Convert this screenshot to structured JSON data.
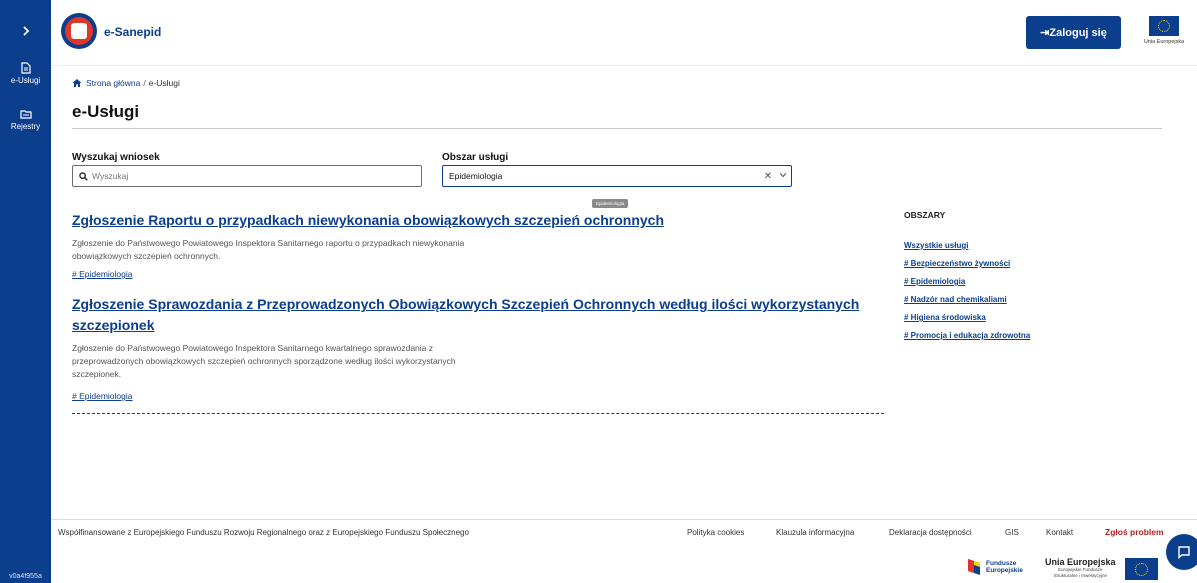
{
  "sidebar": {
    "toggle_icon": "chevron-right-icon",
    "items": [
      {
        "label": "e-Usługi",
        "icon": "document-icon"
      },
      {
        "label": "Rejestry",
        "icon": "folder-icon"
      }
    ],
    "version": "v0a4f955a"
  },
  "header": {
    "brand": "e-Sanepid",
    "login_label": "⇥Zaloguj się",
    "eu_label": "Unia Europejska"
  },
  "breadcrumb": {
    "home": "Strona główna",
    "separator": "/",
    "current": "e-Usługi"
  },
  "page": {
    "title": "e-Usługi"
  },
  "filters": {
    "search_label": "Wyszukaj wniosek",
    "search_placeholder": "Wyszukaj",
    "area_label": "Obszar usługi",
    "area_value": "Epidemiologia",
    "area_tooltip": "Epidemiologia"
  },
  "services": [
    {
      "title": "Zgłoszenie Raportu o przypadkach niewykonania obowiązkowych szczepień ochronnych",
      "desc_lines": [
        "Zgłoszenie do Państwowego Powiatowego Inspektora Sanitarnego raportu o przypadkach niewykonania",
        "obowiązkowych szczepień ochronnych."
      ],
      "tag": "# Epidemiologia"
    },
    {
      "title_lines": [
        "Zgłoszenie Sprawozdania z Przeprowadzonych Obowiązkowych Szczepień Ochronnych według ilości wykorzystanych",
        "szczepionek"
      ],
      "desc_lines": [
        "Zgłoszenie do Państwowego Powiatowego Inspektora Sanitarnego kwartalnego sprawozdania z",
        "przeprowadzonych obowiązkowych szczepień ochronnych sporządzone według ilości wykorzystanych",
        "szczepionek."
      ],
      "tag": "# Epidemiologia"
    }
  ],
  "areas": {
    "title": "OBSZARY",
    "links": [
      "Wszystkie usługi",
      "# Bezpieczeństwo żywności",
      "# Epidemiologia",
      "# Nadzór nad chemikaliami",
      "# Higiena środowiska",
      "# Promocja i edukacja zdrowotna"
    ]
  },
  "footer": {
    "cofinance": "Współfinansowane z Europejskiego Funduszu Rozwoju Regionalnego oraz z Europejskiego Funduszu Społecznego",
    "links": [
      "Polityka cookies",
      "Klauzula informacyjna",
      "Deklaracja dostępności",
      "GIS",
      "Kontakt"
    ],
    "report": "Zgłoś problem",
    "fe_line1": "Fundusze",
    "fe_line2": "Europejskie",
    "ue_title": "Unia Europejska",
    "ue_sub1": "Europejskie Fundusze",
    "ue_sub2": "Strukturalne i Inwestycyjne"
  },
  "colors": {
    "primary": "#0b3e8c",
    "report": "#b3201d"
  }
}
